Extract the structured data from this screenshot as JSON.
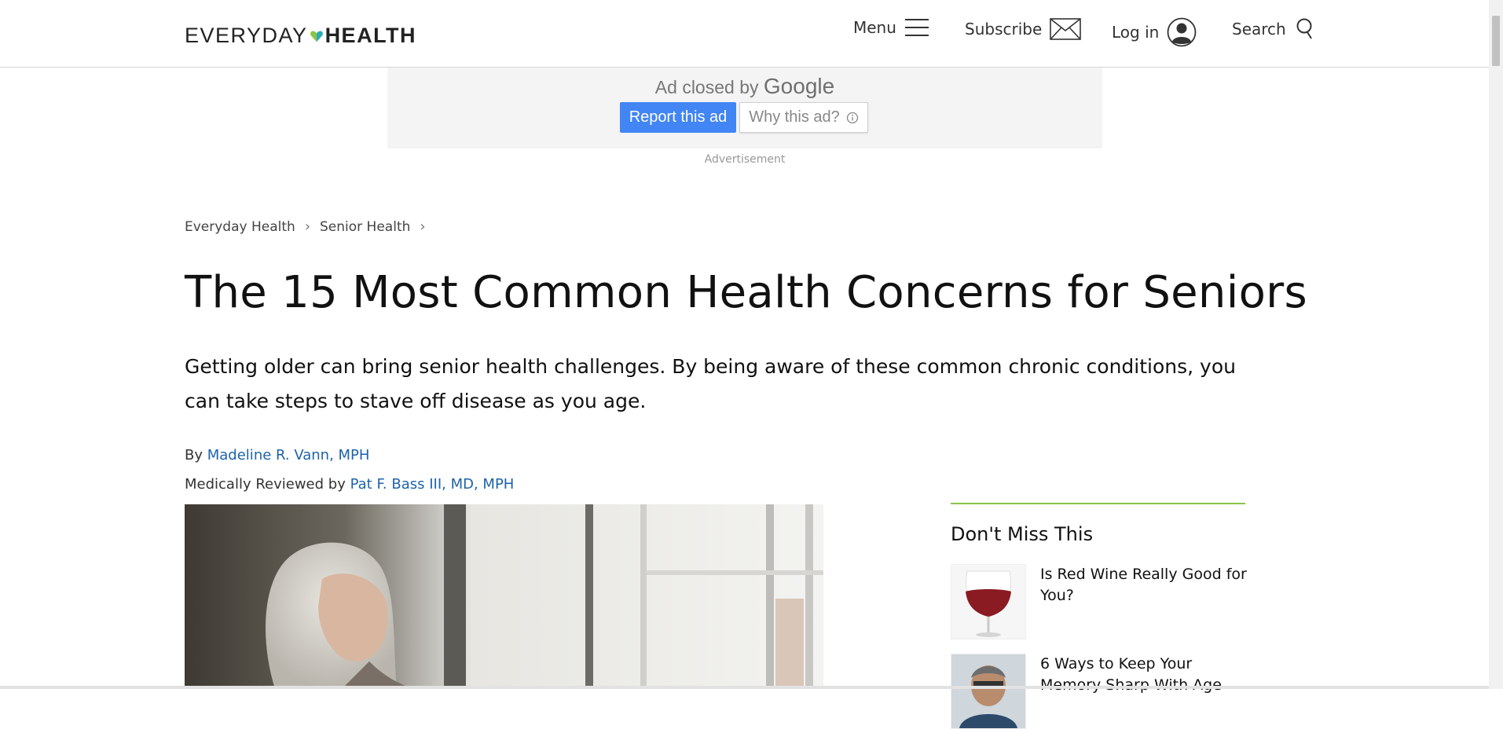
{
  "header": {
    "logo_left": "EVERYDAY",
    "logo_right": "HEALTH",
    "menu_label": "Menu",
    "subscribe_label": "Subscribe",
    "login_label": "Log in",
    "search_label": "Search"
  },
  "ad": {
    "closed_text": "Ad closed by",
    "google_text": "Google",
    "report_label": "Report this ad",
    "why_label": "Why this ad?",
    "advertisement_label": "Advertisement"
  },
  "breadcrumb": {
    "items": [
      {
        "label": "Everyday Health"
      },
      {
        "label": "Senior Health"
      }
    ]
  },
  "article": {
    "title": "The 15 Most Common Health Concerns for Seniors",
    "dek": "Getting older can bring senior health challenges. By being aware of these common chronic conditions, you can take steps to stave off disease as you age.",
    "byline_prefix": "By",
    "author": "Madeline R. Vann, MPH",
    "reviewed_prefix": "Medically Reviewed by",
    "reviewer": "Pat F. Bass III, MD, MPH"
  },
  "sidebar": {
    "title": "Don't Miss This",
    "items": [
      {
        "label": "Is Red Wine Really Good for You?"
      },
      {
        "label": "6 Ways to Keep Your Memory Sharp With Age"
      }
    ]
  },
  "colors": {
    "link": "#1d63a8",
    "ad_button": "#4285f4",
    "sidebar_rule": "#8bc34a",
    "logo_heart_left": "#8cc63f",
    "logo_heart_right": "#29abb8"
  }
}
